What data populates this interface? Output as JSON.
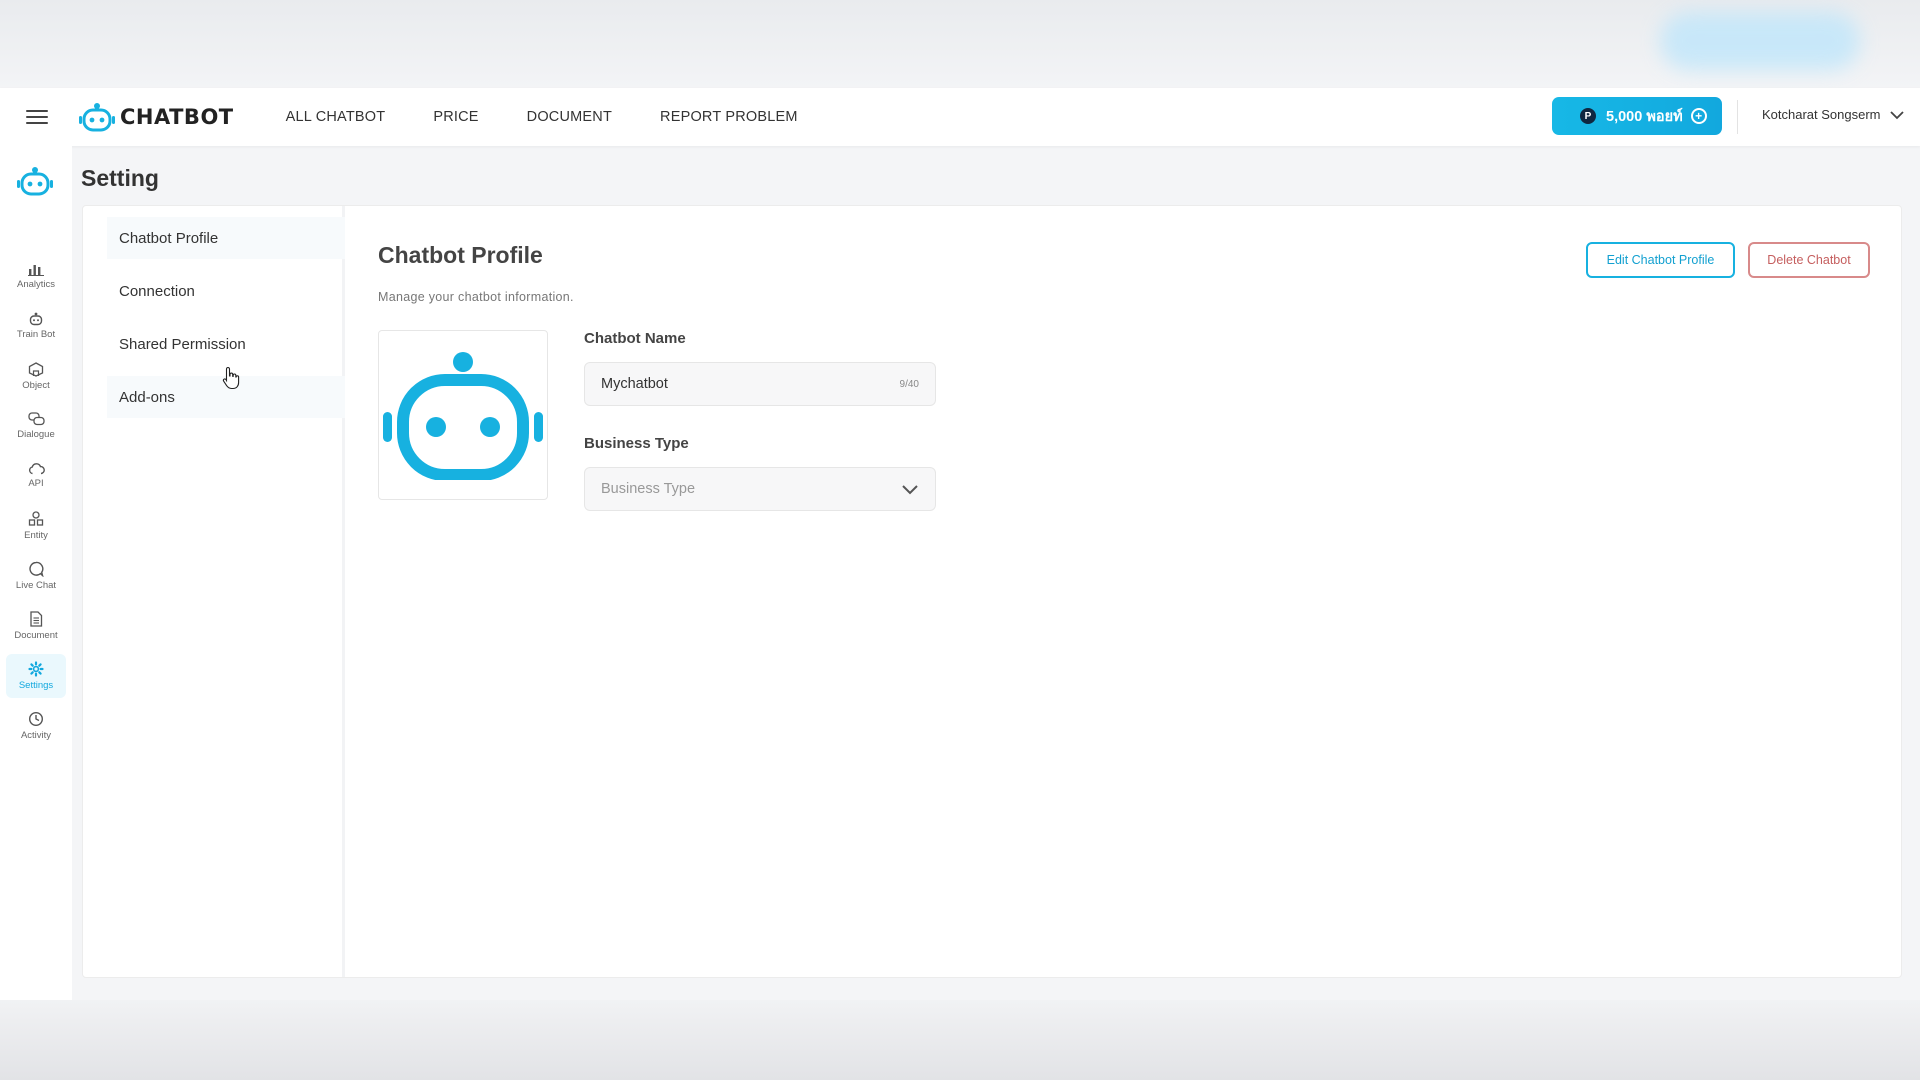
{
  "app": {
    "logo_text": "CHATBOT"
  },
  "header": {
    "nav": [
      "ALL CHATBOT",
      "PRICE",
      "DOCUMENT",
      "REPORT PROBLEM"
    ],
    "points_label": "5,000 พอยท์",
    "user_name": "Kotcharat Songserm"
  },
  "rail": {
    "items": [
      {
        "label": "Analytics",
        "icon": "bar-chart-icon"
      },
      {
        "label": "Train Bot",
        "icon": "robot-icon"
      },
      {
        "label": "Object",
        "icon": "cube-icon"
      },
      {
        "label": "Dialogue",
        "icon": "chat-bubbles-icon"
      },
      {
        "label": "API",
        "icon": "cloud-icon"
      },
      {
        "label": "Entity",
        "icon": "shapes-icon"
      },
      {
        "label": "Live Chat",
        "icon": "chat-bubble-icon"
      },
      {
        "label": "Document",
        "icon": "document-icon"
      },
      {
        "label": "Settings",
        "icon": "gear-icon",
        "active": true
      },
      {
        "label": "Activity",
        "icon": "clock-icon"
      }
    ]
  },
  "page": {
    "title": "Setting"
  },
  "sub_nav": {
    "items": [
      "Chatbot Profile",
      "Connection",
      "Shared Permission",
      "Add-ons"
    ]
  },
  "main": {
    "title": "Chatbot Profile",
    "subtitle": "Manage your chatbot information.",
    "edit_label": "Edit Chatbot Profile",
    "delete_label": "Delete Chatbot",
    "name_label": "Chatbot Name",
    "name_value": "Mychatbot",
    "name_counter": "9/40",
    "type_label": "Business Type",
    "type_placeholder": "Business Type"
  },
  "colors": {
    "accent": "#12a8de",
    "danger": "#c55e5e"
  }
}
